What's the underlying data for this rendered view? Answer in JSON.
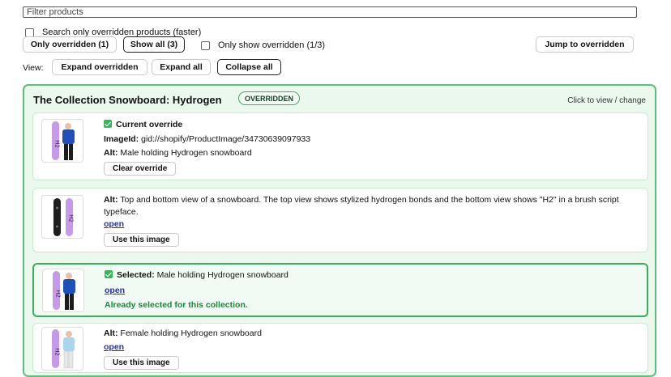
{
  "filter": {
    "placeholder": "Filter products"
  },
  "search_only": {
    "label": "Search only overridden products (faster)"
  },
  "toolbar": {
    "only_overridden": "Only overridden (1)",
    "show_all": "Show all (3)",
    "only_show_overridden": "Only show overridden (1/3)",
    "jump_to_overridden": "Jump to overridden"
  },
  "view": {
    "label": "View:",
    "expand_overridden": "Expand overridden",
    "expand_all": "Expand all",
    "collapse_all": "Collapse all"
  },
  "collection": {
    "title": "The Collection Snowboard: Hydrogen",
    "badge": "OVERRIDDEN",
    "hint": "Click to view / change",
    "current": {
      "heading": "Current override",
      "image_id_label": "ImageId:",
      "image_id": "gid://shopify/ProductImage/34730639097933",
      "alt_label": "Alt:",
      "alt": "Male holding Hydrogen snowboard",
      "clear_button": "Clear override"
    },
    "options": [
      {
        "alt_label": "Alt:",
        "alt": "Top and bottom view of a snowboard. The top view shows stylized hydrogen bonds and the bottom view shows \"H2\" in a brush script typeface.",
        "link": "open",
        "button": "Use this image"
      },
      {
        "selected_label": "Selected:",
        "alt": "Male holding Hydrogen snowboard",
        "link": "open",
        "status": "Already selected for this collection."
      },
      {
        "alt_label": "Alt:",
        "alt": "Female holding Hydrogen snowboard",
        "link": "open",
        "button": "Use this image"
      }
    ]
  },
  "colors": {
    "accent_green": "#3daa5c",
    "link_blue": "#1f2fb8",
    "card_bg": "#eaf8ee"
  }
}
